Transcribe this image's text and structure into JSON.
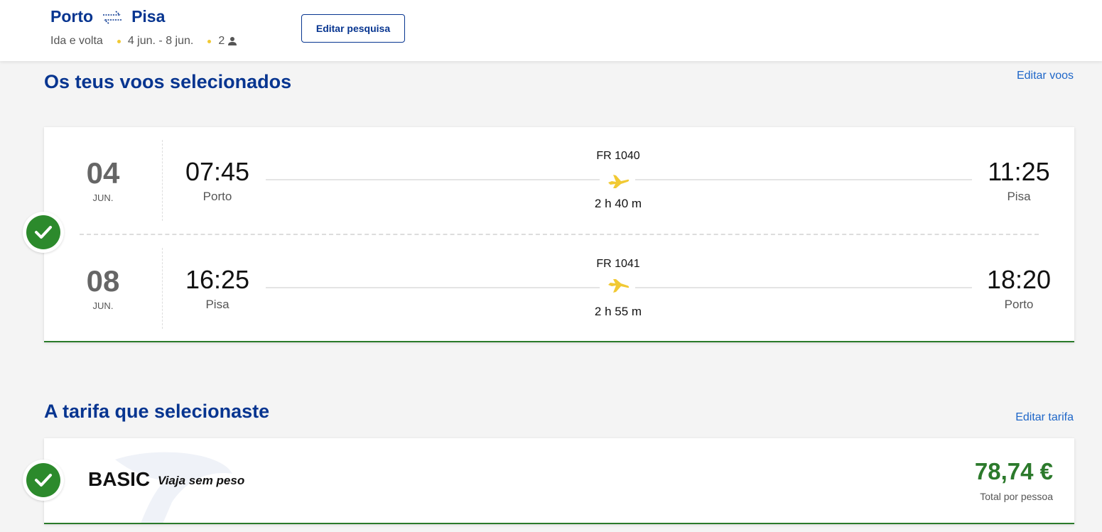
{
  "header": {
    "origin": "Porto",
    "destination": "Pisa",
    "trip_type": "Ida e volta",
    "dates": "4 jun. - 8 jun.",
    "passengers": "2",
    "edit_search_label": "Editar pesquisa"
  },
  "flights_section": {
    "title": "Os teus voos selecionados",
    "edit_label": "Editar voos",
    "flights": [
      {
        "day": "04",
        "month": "JUN.",
        "depart_time": "07:45",
        "depart_city": "Porto",
        "flight_no": "FR 1040",
        "duration": "2 h 40 m",
        "arrive_time": "11:25",
        "arrive_city": "Pisa"
      },
      {
        "day": "08",
        "month": "JUN.",
        "depart_time": "16:25",
        "depart_city": "Pisa",
        "flight_no": "FR 1041",
        "duration": "2 h 55 m",
        "arrive_time": "18:20",
        "arrive_city": "Porto"
      }
    ]
  },
  "fare_section": {
    "title": "A tarifa que selecionaste",
    "edit_label": "Editar tarifa",
    "fare_name": "BASIC",
    "fare_tagline": "Viaja sem peso",
    "price": "78,74 €",
    "price_note": "Total por pessoa"
  },
  "colors": {
    "brand": "#073590",
    "accent": "#f1c933",
    "success": "#2c8a2c",
    "link": "#1e66c8"
  },
  "icons": [
    "swap-arrows-icon",
    "person-icon",
    "check-icon",
    "plane-icon"
  ]
}
